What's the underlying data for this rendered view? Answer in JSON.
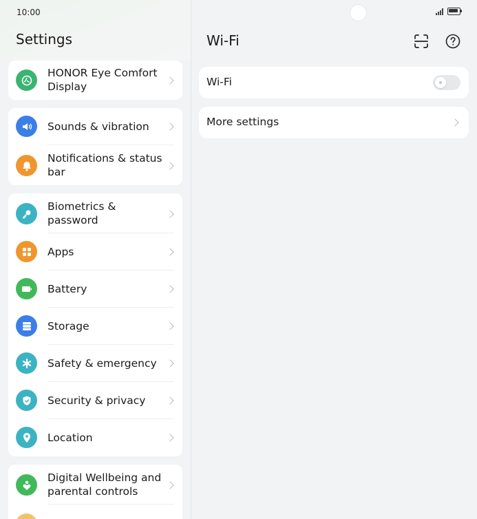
{
  "status_bar": {
    "time": "10:00"
  },
  "settings": {
    "title": "Settings",
    "groups": [
      {
        "items": [
          {
            "label": "HONOR Eye Comfort Display",
            "icon": "eye-comfort-icon",
            "color": "#3cb371"
          }
        ]
      },
      {
        "items": [
          {
            "label": "Sounds & vibration",
            "icon": "speaker-icon",
            "color": "#3b7ee8"
          },
          {
            "label": "Notifications & status bar",
            "icon": "bell-icon",
            "color": "#f0962f"
          }
        ]
      },
      {
        "items": [
          {
            "label": "Biometrics & password",
            "icon": "key-icon",
            "color": "#3bb3c3"
          },
          {
            "label": "Apps",
            "icon": "apps-icon",
            "color": "#f0962f"
          },
          {
            "label": "Battery",
            "icon": "battery-icon",
            "color": "#41b95a"
          },
          {
            "label": "Storage",
            "icon": "storage-icon",
            "color": "#3b7ee8"
          },
          {
            "label": "Safety & emergency",
            "icon": "asterisk-icon",
            "color": "#3bb3c3"
          },
          {
            "label": "Security & privacy",
            "icon": "shield-icon",
            "color": "#3bb3c3"
          },
          {
            "label": "Location",
            "icon": "location-pin-icon",
            "color": "#3bb3c3"
          }
        ]
      },
      {
        "items": [
          {
            "label": "Digital Wellbeing and parental controls",
            "icon": "heart-person-icon",
            "color": "#41b95a"
          }
        ]
      }
    ]
  },
  "wifi_page": {
    "title": "Wi-Fi",
    "toggle": {
      "label": "Wi-Fi",
      "state": "off"
    },
    "more_settings_label": "More settings"
  }
}
